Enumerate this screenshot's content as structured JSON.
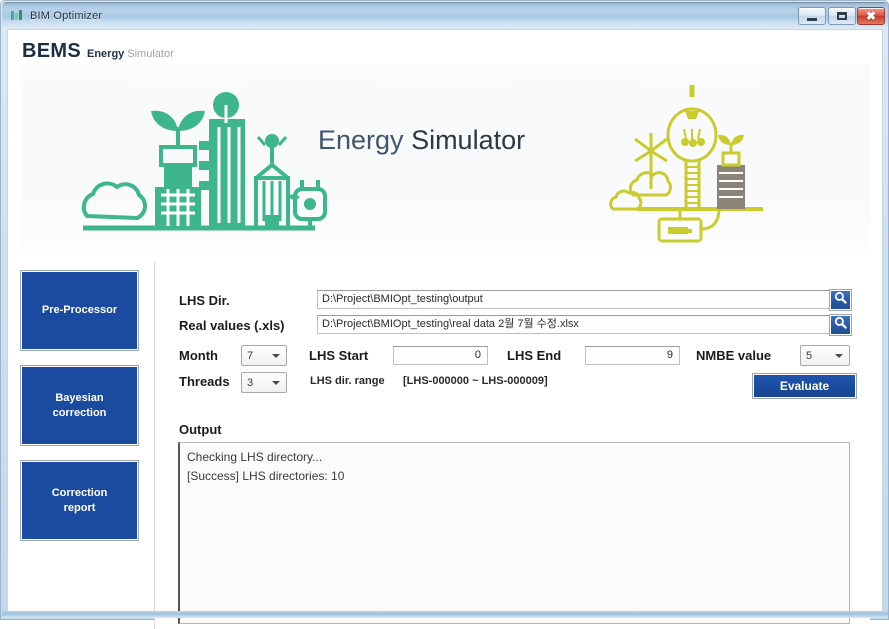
{
  "window": {
    "title": "BIM Optimizer",
    "app_icon": "bim-app-icon",
    "minimize_label": "Minimize",
    "maximize_label": "Maximize",
    "close_label": "Close"
  },
  "logo": {
    "bems": "BEMS",
    "energy": "Energy",
    "simulator": "Simulator"
  },
  "banner": {
    "title_first": "Energy ",
    "title_second": "Simulator",
    "left_illustration": "green-city-buildings-plant-cloud-plug-illustration",
    "right_illustration": "yellow-lightbulb-windmill-cloud-battery-illustration"
  },
  "sidebar": {
    "items": [
      {
        "label": "Pre-Processor",
        "name": "sidebar-item-pre-processor"
      },
      {
        "label": "Bayesian\ncorrection",
        "line1": "Bayesian",
        "line2": "correction",
        "name": "sidebar-item-bayesian-correction"
      },
      {
        "label": "Correction\nreport",
        "line1": "Correction",
        "line2": "report",
        "name": "sidebar-item-correction-report"
      }
    ]
  },
  "form": {
    "lhs_dir_label": "LHS Dir.",
    "lhs_dir_value": "D:\\Project\\BMIOpt_testing\\output",
    "real_values_label": "Real values (.xls)",
    "real_values_value": "D:\\Project\\BMIOpt_testing\\real data 2월 7월 수정.xlsx",
    "browse_icon": "search-icon",
    "month_label": "Month",
    "month_value": "7",
    "threads_label": "Threads",
    "threads_value": "3",
    "lhs_start_label": "LHS Start",
    "lhs_start_value": "0",
    "lhs_end_label": "LHS End",
    "lhs_end_value": "9",
    "nmbe_label": "NMBE value",
    "nmbe_value": "5",
    "range_label": "LHS dir. range",
    "range_value": "[LHS-000000 ~ LHS-000009]",
    "evaluate_label": "Evaluate"
  },
  "output": {
    "label": "Output",
    "lines": [
      "Checking LHS directory...",
      "[Success] LHS directories: 10"
    ]
  },
  "colors": {
    "accent_blue": "#1b4ba0",
    "banner_green": "#3cb68a",
    "banner_yellow": "#c9cc2c",
    "title_navy": "#1d2d44",
    "close_red": "#c4392a"
  }
}
